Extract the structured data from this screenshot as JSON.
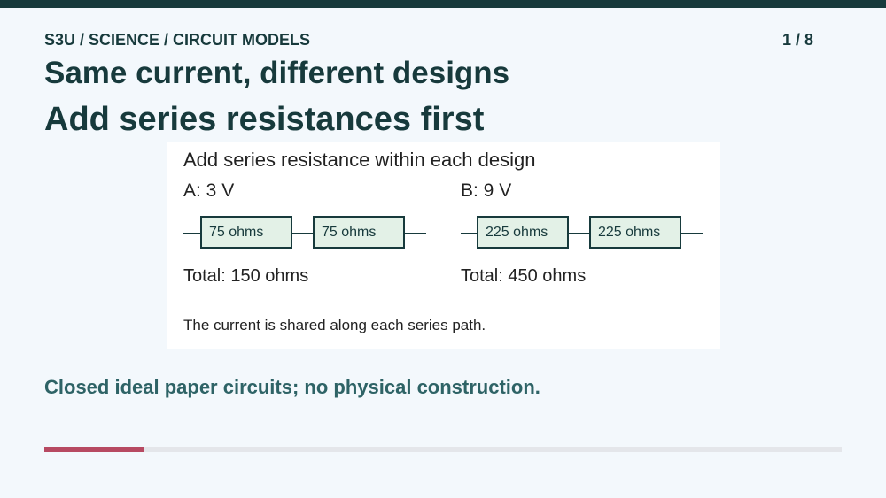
{
  "header": {
    "breadcrumb": "S3U / SCIENCE / CIRCUIT MODELS",
    "page_indicator": "1 / 8"
  },
  "title": "Same current, different designs",
  "heading": "Add series resistances first",
  "panel": {
    "title": "Add series resistance within each design",
    "designs": [
      {
        "label": "A: 3 V",
        "resistors": [
          "75 ohms",
          "75 ohms"
        ],
        "total": "Total: 150 ohms"
      },
      {
        "label": "B: 9 V",
        "resistors": [
          "225 ohms",
          "225 ohms"
        ],
        "total": "Total: 450 ohms"
      }
    ],
    "note": "The current is shared along each series path."
  },
  "footer": "Closed ideal paper circuits; no physical construction.",
  "progress": {
    "current": 1,
    "total": 8,
    "fraction": 0.125
  },
  "colors": {
    "dark": "#173a3c",
    "accent": "#b74a62",
    "resistor_fill": "#e3f1e7",
    "footer_text": "#2e6366"
  }
}
